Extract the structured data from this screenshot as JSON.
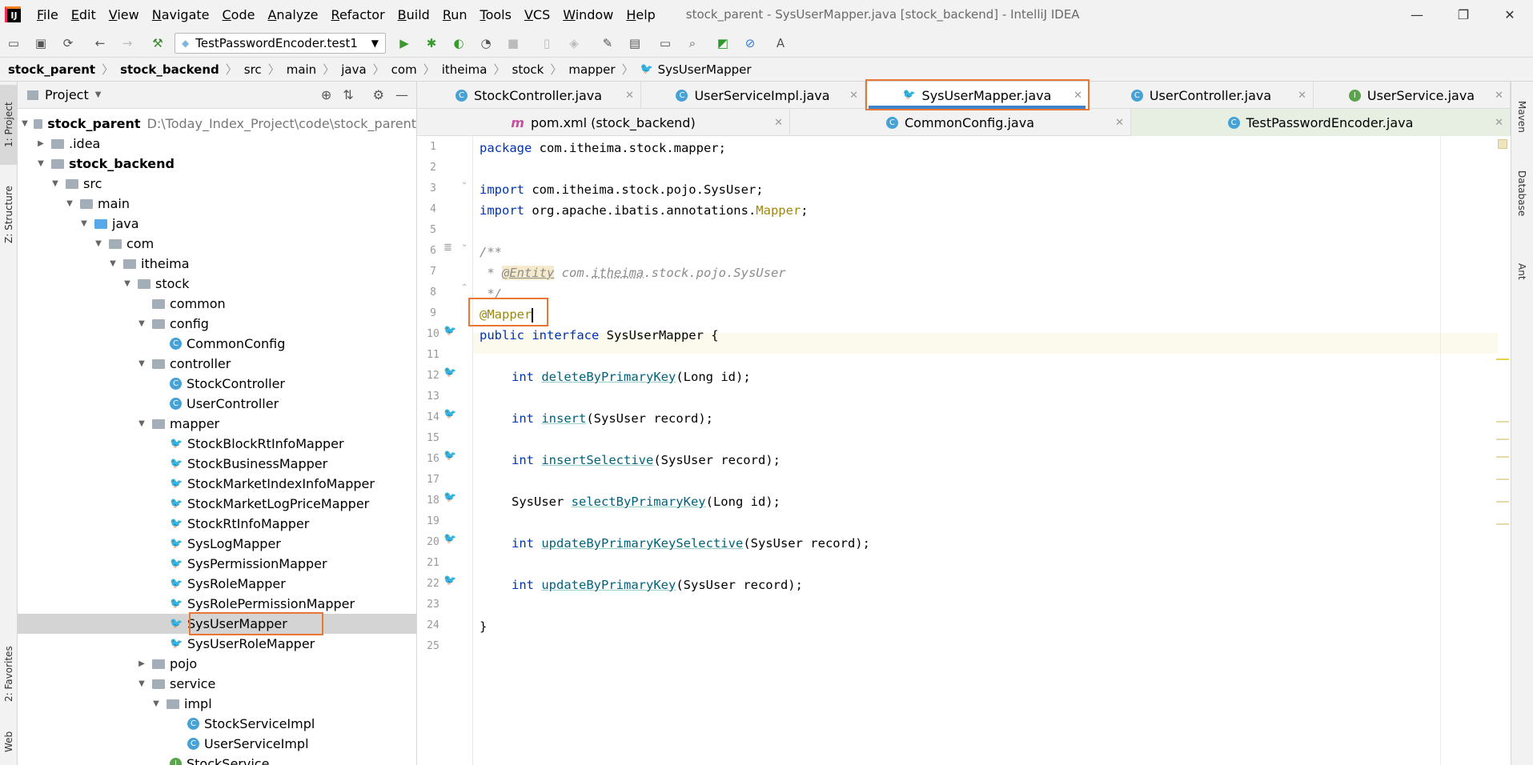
{
  "titlebar": {
    "menu": [
      "File",
      "Edit",
      "View",
      "Navigate",
      "Code",
      "Analyze",
      "Refactor",
      "Build",
      "Run",
      "Tools",
      "VCS",
      "Window",
      "Help"
    ],
    "title": "stock_parent - SysUserMapper.java [stock_backend] - IntelliJ IDEA",
    "app_icon": "IJ",
    "controls": {
      "minimize": "—",
      "restore": "❐",
      "close": "✕"
    }
  },
  "toolbar": {
    "run_config": "TestPasswordEncoder.test1"
  },
  "breadcrumb": [
    "stock_parent",
    "stock_backend",
    "src",
    "main",
    "java",
    "com",
    "itheima",
    "stock",
    "mapper",
    "SysUserMapper"
  ],
  "left_tabs": {
    "project": "1: Project",
    "structure": "Z: Structure",
    "favorites": "2: Favorites",
    "web": "Web"
  },
  "right_tabs": {
    "maven": "Maven",
    "database": "Database",
    "ant": "Ant"
  },
  "project_panel": {
    "title": "Project",
    "tree": [
      {
        "label": "stock_parent",
        "path": "D:\\Today_Index_Project\\code\\stock_parent"
      },
      {
        "label": ".idea"
      },
      {
        "label": "stock_backend"
      },
      {
        "label": "src"
      },
      {
        "label": "main"
      },
      {
        "label": "java"
      },
      {
        "label": "com"
      },
      {
        "label": "itheima"
      },
      {
        "label": "stock"
      },
      {
        "label": "common"
      },
      {
        "label": "config"
      },
      {
        "label": "CommonConfig"
      },
      {
        "label": "controller"
      },
      {
        "label": "StockController"
      },
      {
        "label": "UserController"
      },
      {
        "label": "mapper"
      },
      {
        "label": "StockBlockRtInfoMapper"
      },
      {
        "label": "StockBusinessMapper"
      },
      {
        "label": "StockMarketIndexInfoMapper"
      },
      {
        "label": "StockMarketLogPriceMapper"
      },
      {
        "label": "StockRtInfoMapper"
      },
      {
        "label": "SysLogMapper"
      },
      {
        "label": "SysPermissionMapper"
      },
      {
        "label": "SysRoleMapper"
      },
      {
        "label": "SysRolePermissionMapper"
      },
      {
        "label": "SysUserMapper"
      },
      {
        "label": "SysUserRoleMapper"
      },
      {
        "label": "pojo"
      },
      {
        "label": "service"
      },
      {
        "label": "impl"
      },
      {
        "label": "StockServiceImpl"
      },
      {
        "label": "UserServiceImpl"
      },
      {
        "label": "StockService"
      }
    ]
  },
  "editor": {
    "tabs_row1": [
      "StockController.java",
      "UserServiceImpl.java",
      "SysUserMapper.java",
      "UserController.java",
      "UserService.java"
    ],
    "tabs_row2": [
      "pom.xml (stock_backend)",
      "CommonConfig.java",
      "TestPasswordEncoder.java"
    ],
    "line_numbers": [
      "1",
      "2",
      "3",
      "4",
      "5",
      "6",
      "7",
      "8",
      "9",
      "10",
      "11",
      "12",
      "13",
      "14",
      "15",
      "16",
      "17",
      "18",
      "19",
      "20",
      "21",
      "22",
      "23",
      "24",
      "25"
    ],
    "code": {
      "l1_kw": "package",
      "l1_rest": " com.itheima.stock.mapper;",
      "l3_kw": "import",
      "l3_rest": " com.itheima.stock.pojo.SysUser;",
      "l4_kw": "import",
      "l4_rest": " org.apache.ibatis.annotations.",
      "l4_ann": "Mapper",
      "l4_end": ";",
      "l6": "/**",
      "l7_star": " * ",
      "l7_tag": "@Entity",
      "l7_a": " com.",
      "l7_b": "itheima",
      "l7_c": ".stock.pojo.SysUser",
      "l8": " */",
      "l9": "@Mapper",
      "l10_kw": "public interface",
      "l10_rest": " SysUserMapper {",
      "l12_kw": "int",
      "l12_m": "deleteByPrimaryKey",
      "l12_rest": "(Long id);",
      "l14_kw": "int",
      "l14_m": "insert",
      "l14_rest": "(SysUser record);",
      "l16_kw": "int",
      "l16_m": "insertSelective",
      "l16_rest": "(SysUser record);",
      "l18_t": "SysUser ",
      "l18_m": "selectByPrimaryKey",
      "l18_rest": "(Long id);",
      "l20_kw": "int",
      "l20_m": "updateByPrimaryKeySelective",
      "l20_rest": "(SysUser record);",
      "l22_kw": "int",
      "l22_m": "updateByPrimaryKey",
      "l22_rest": "(SysUser record);",
      "l24": "}"
    }
  },
  "colors": {
    "accent": "#4083c9",
    "highlight_box": "#e87733",
    "keyword": "#0033b3",
    "annotation": "#9e880d"
  }
}
